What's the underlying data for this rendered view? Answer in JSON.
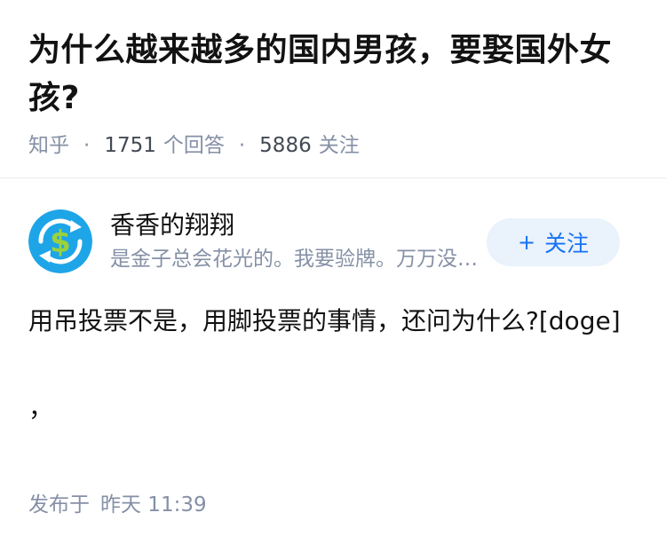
{
  "question": {
    "title": "为什么越来越多的国内男孩，要娶国外女孩?",
    "source": "知乎",
    "answers_count": "1751",
    "answers_label": "个回答",
    "followers_count": "5886",
    "followers_label": "关注",
    "separator": "·"
  },
  "author": {
    "name": "香香的翔翔",
    "bio": "是金子总会花光的。我要验牌。万万没想到",
    "avatar_icon": "dollar-exchange-icon",
    "follow_label": "关注",
    "follow_icon": "plus-icon"
  },
  "answer": {
    "line1": "用吊投票不是，用脚投票的事情，还问为什么?[doge]",
    "line2": "，"
  },
  "published": {
    "label": "发布于",
    "time": "昨天 11:39"
  },
  "colors": {
    "accent": "#1772f6",
    "follow_bg": "#eaf2fb",
    "muted_text": "#8590a6",
    "avatar_blue": "#1ea5e8",
    "avatar_green": "#9bd23c"
  }
}
